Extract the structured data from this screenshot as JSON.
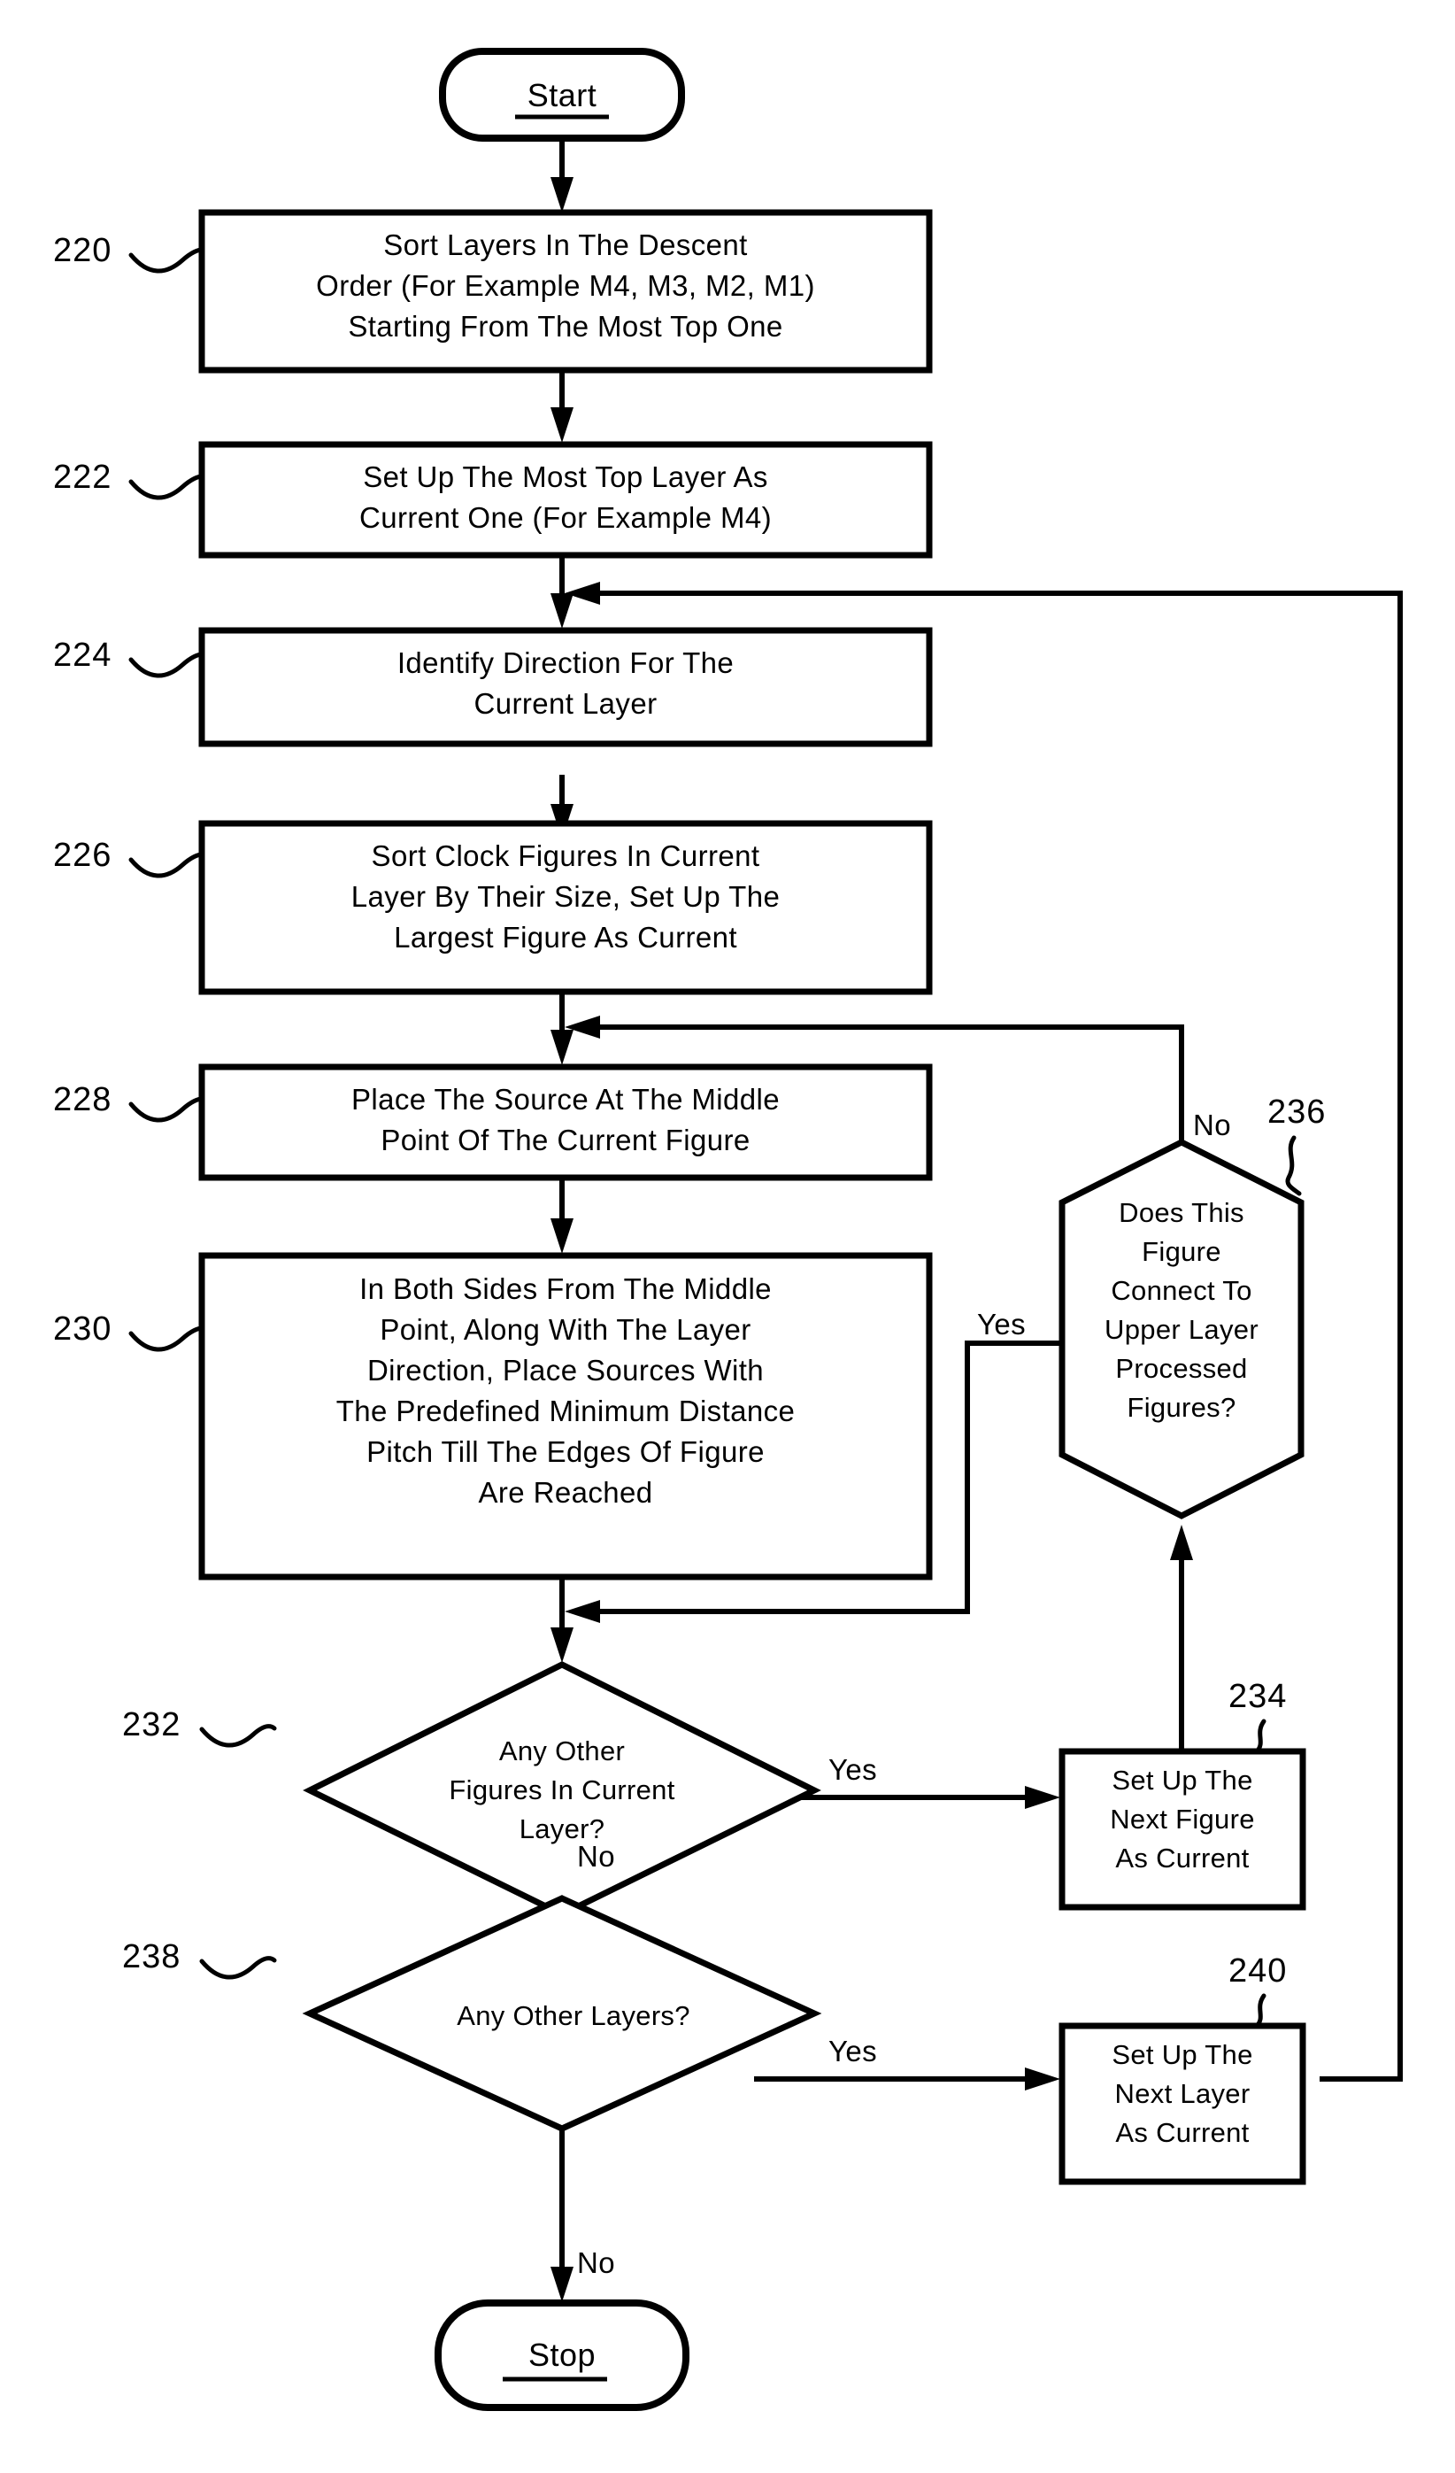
{
  "figure": {
    "type": "flowchart",
    "title": "Clock source placement flowchart",
    "start_label": "Start",
    "stop_label": "Stop"
  },
  "nodes": [
    {
      "id": "start",
      "ref": "",
      "shape": "terminator",
      "lines": [
        "Start"
      ]
    },
    {
      "id": "n220",
      "ref": "220",
      "shape": "process",
      "lines": [
        "Sort Layers In The Descent",
        "Order (For Example M4, M3, M2, M1)",
        "Starting From The Most Top One"
      ]
    },
    {
      "id": "n222",
      "ref": "222",
      "shape": "process",
      "lines": [
        "Set Up The Most Top Layer As",
        "Current One (For Example M4)"
      ]
    },
    {
      "id": "n224",
      "ref": "224",
      "shape": "process",
      "lines": [
        "Identify Direction For The",
        "Current Layer"
      ]
    },
    {
      "id": "n226",
      "ref": "226",
      "shape": "process",
      "lines": [
        "Sort Clock Figures In Current",
        "Layer By Their Size, Set Up The",
        "Largest Figure As Current"
      ]
    },
    {
      "id": "n228",
      "ref": "228",
      "shape": "process",
      "lines": [
        "Place The Source At The Middle",
        "Point Of The Current Figure"
      ]
    },
    {
      "id": "n230",
      "ref": "230",
      "shape": "process",
      "lines": [
        "In Both Sides From The Middle",
        "Point, Along With The Layer",
        "Direction, Place Sources With",
        "The Predefined Minimum Distance",
        "Pitch Till The Edges Of Figure",
        "Are Reached"
      ]
    },
    {
      "id": "n232",
      "ref": "232",
      "shape": "decision",
      "lines": [
        "Any Other",
        "Figures In Current",
        "Layer?"
      ]
    },
    {
      "id": "n234",
      "ref": "234",
      "shape": "process",
      "lines": [
        "Set Up The",
        "Next Figure",
        "As Current"
      ]
    },
    {
      "id": "n236",
      "ref": "236",
      "shape": "hexagon",
      "lines": [
        "Does This",
        "Figure",
        "Connect To",
        "Upper Layer",
        "Processed",
        "Figures?"
      ]
    },
    {
      "id": "n238",
      "ref": "238",
      "shape": "decision",
      "lines": [
        "Any Other Layers?"
      ]
    },
    {
      "id": "n240",
      "ref": "240",
      "shape": "process",
      "lines": [
        "Set Up The",
        "Next Layer",
        "As Current"
      ]
    },
    {
      "id": "stop",
      "ref": "",
      "shape": "terminator",
      "lines": [
        "Stop"
      ]
    }
  ],
  "edge_labels": {
    "e232_yes": "Yes",
    "e232_no": "No",
    "e236_yes": "Yes",
    "e236_no": "No",
    "e238_yes": "Yes",
    "e238_no": "No"
  },
  "reference_numbers": {
    "r220": "220",
    "r222": "222",
    "r224": "224",
    "r226": "226",
    "r228": "228",
    "r230": "230",
    "r232": "232",
    "r234": "234",
    "r236": "236",
    "r238": "238",
    "r240": "240"
  },
  "colors": {
    "stroke": "#000000",
    "fill": "#ffffff",
    "background": "#ffffff"
  }
}
